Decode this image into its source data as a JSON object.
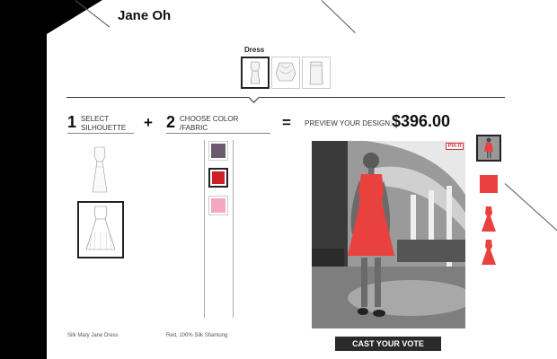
{
  "designer_name": "Jane Oh",
  "categories": {
    "label": "Dress",
    "items": [
      {
        "name": "Sheath dress"
      },
      {
        "name": "Draped dress"
      },
      {
        "name": "Pencil skirt"
      }
    ]
  },
  "steps": {
    "step1": {
      "number": "1",
      "label_line1": "SELECT",
      "label_line2": "SILHOUETTE"
    },
    "plus": "+",
    "step2": {
      "number": "2",
      "label_line1": "CHOOSE COLOR",
      "label_line2": "/FABRIC"
    },
    "equals": "=",
    "preview_label": "PREVIEW YOUR DESIGN:",
    "price": "$396.00"
  },
  "swatches": [
    {
      "color": "#6e5a70"
    },
    {
      "color": "#cc1f2a"
    },
    {
      "color": "#f4a7bd"
    }
  ],
  "selected_color": "#e8413e",
  "pinit_label": "Pin it",
  "captions": {
    "silhouette": "Silk Mary Jane Dress",
    "fabric": "Red, 100% Silk Shantung"
  },
  "vote_button": "CAST YOUR VOTE"
}
